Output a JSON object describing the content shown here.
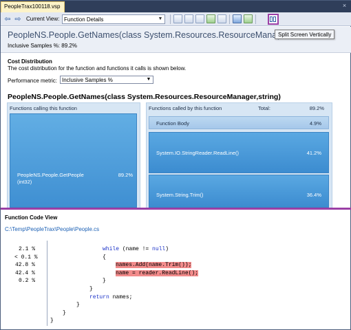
{
  "tab": {
    "title": "PeopleTrax100118.vsp",
    "close_glyph": "×"
  },
  "toolbar": {
    "current_view_label": "Current View:",
    "current_view_value": "Function Details",
    "back_glyph": "⇦",
    "forward_glyph": "⇨",
    "dropdown_glyph": "▼"
  },
  "tooltip": "Split Screen Vertically",
  "header": {
    "function_title": "PeopleNS.People.GetNames(class System.Resources.ResourceManager,string)",
    "inclusive_samples": "Inclusive Samples %: 89.2%"
  },
  "cost": {
    "title": "Cost Distribution",
    "description": "The cost distribution for the function and functions it calls is shown below.",
    "metric_label": "Performance metric:",
    "metric_value": "Inclusive Samples %"
  },
  "signature": "PeopleNS.People.GetNames(class System.Resources.ResourceManager,string)",
  "callers": {
    "header": "Functions calling this function",
    "items": [
      {
        "name": "PeopleNS.People.GetPeople (int32)",
        "pct": "89.2%"
      }
    ]
  },
  "callees": {
    "header": "Functions called by this function",
    "total_label": "Total:",
    "total_pct": "89.2%",
    "function_body": {
      "name": "Function Body",
      "pct": "4.9%"
    },
    "items": [
      {
        "name": "System.IO.StringReader.ReadLine()",
        "pct": "41.2%"
      },
      {
        "name": "System.String.Trim()",
        "pct": "36.4%"
      }
    ]
  },
  "code_view": {
    "title": "Function Code View",
    "path": "C:\\Temp\\PeopleTrax\\People\\People.cs",
    "gutter": [
      "2.1 %",
      "< 0.1 %",
      "42.8 %",
      "42.4 %",
      "0.2 %"
    ],
    "lines": [
      "while (name != null)",
      "{",
      "names.Add(name.Trim());",
      "name = reader.ReadLine();",
      "}",
      "}",
      "return names;",
      "}",
      "}",
      "}"
    ]
  },
  "colors": {
    "splitter": "#9b3fa6",
    "bar_blue": "#3f8fd2",
    "highlight": "#f28b8b",
    "keyword": "#1b32c8"
  }
}
